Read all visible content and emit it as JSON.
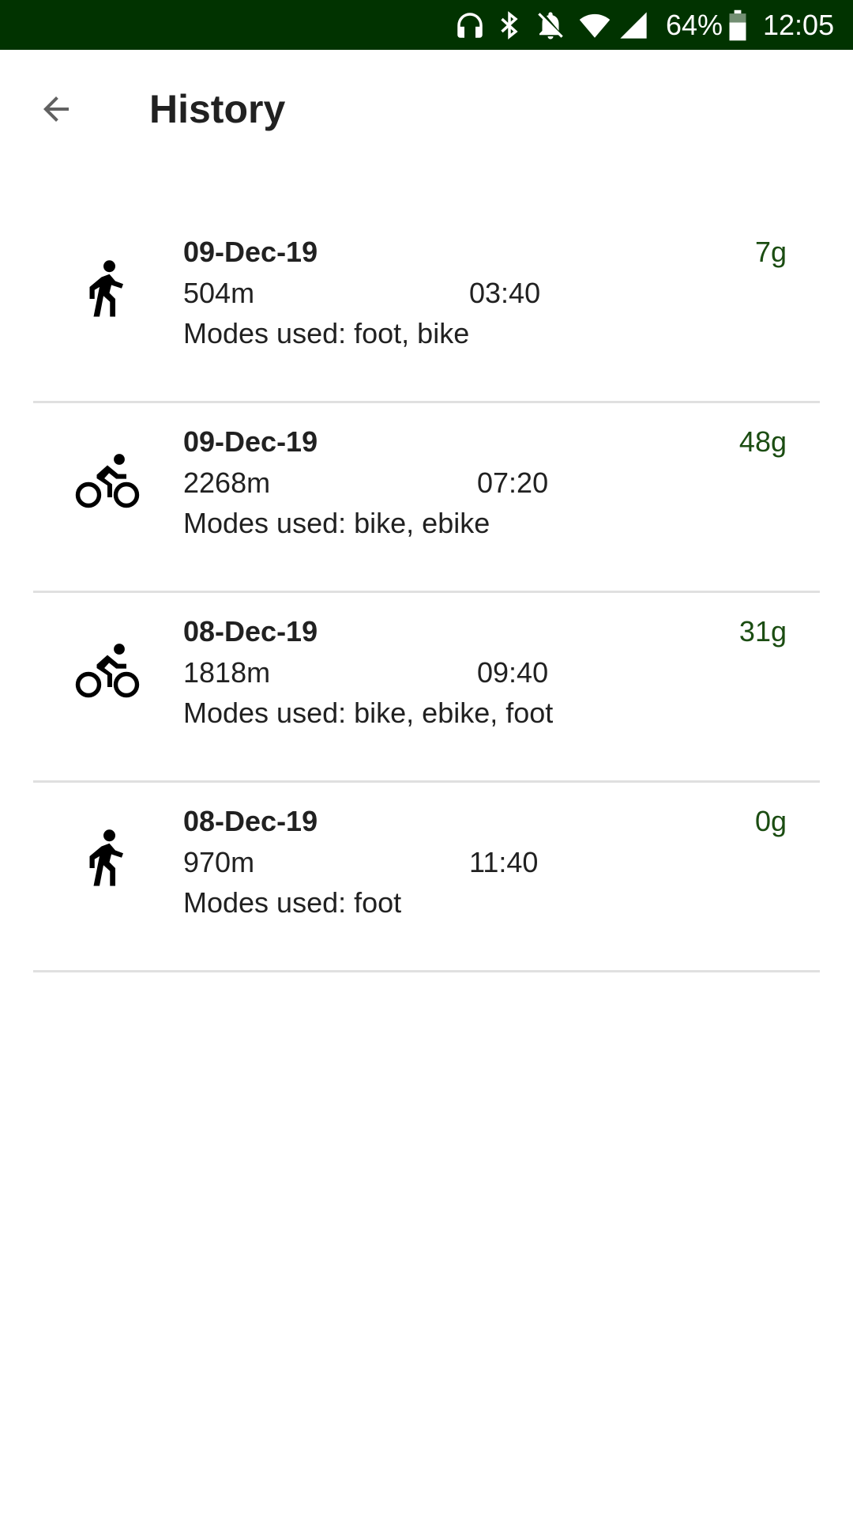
{
  "status_bar": {
    "battery_percent": "64%",
    "time": "12:05",
    "icons": [
      "headphones-icon",
      "bluetooth-icon",
      "notifications-off-icon",
      "wifi-icon",
      "cell-signal-icon",
      "battery-icon"
    ],
    "background_color": "#013300"
  },
  "app_bar": {
    "title": "History",
    "back_icon": "arrow-back-icon"
  },
  "history": [
    {
      "icon": "walk-icon",
      "date": "09-Dec-19",
      "distance": "504m",
      "time": "03:40",
      "modes": "Modes used: foot, bike",
      "emission": "7g"
    },
    {
      "icon": "bike-icon",
      "date": "09-Dec-19",
      "distance": "2268m",
      "time": "07:20",
      "modes": "Modes used: bike, ebike",
      "emission": "48g"
    },
    {
      "icon": "bike-icon",
      "date": "08-Dec-19",
      "distance": "1818m",
      "time": "09:40",
      "modes": "Modes used: bike, ebike, foot",
      "emission": "31g"
    },
    {
      "icon": "walk-icon",
      "date": "08-Dec-19",
      "distance": "970m",
      "time": "11:40",
      "modes": "Modes used: foot",
      "emission": "0g"
    }
  ],
  "colors": {
    "accent_green": "#1b4d12",
    "divider": "#e0e0e0"
  }
}
